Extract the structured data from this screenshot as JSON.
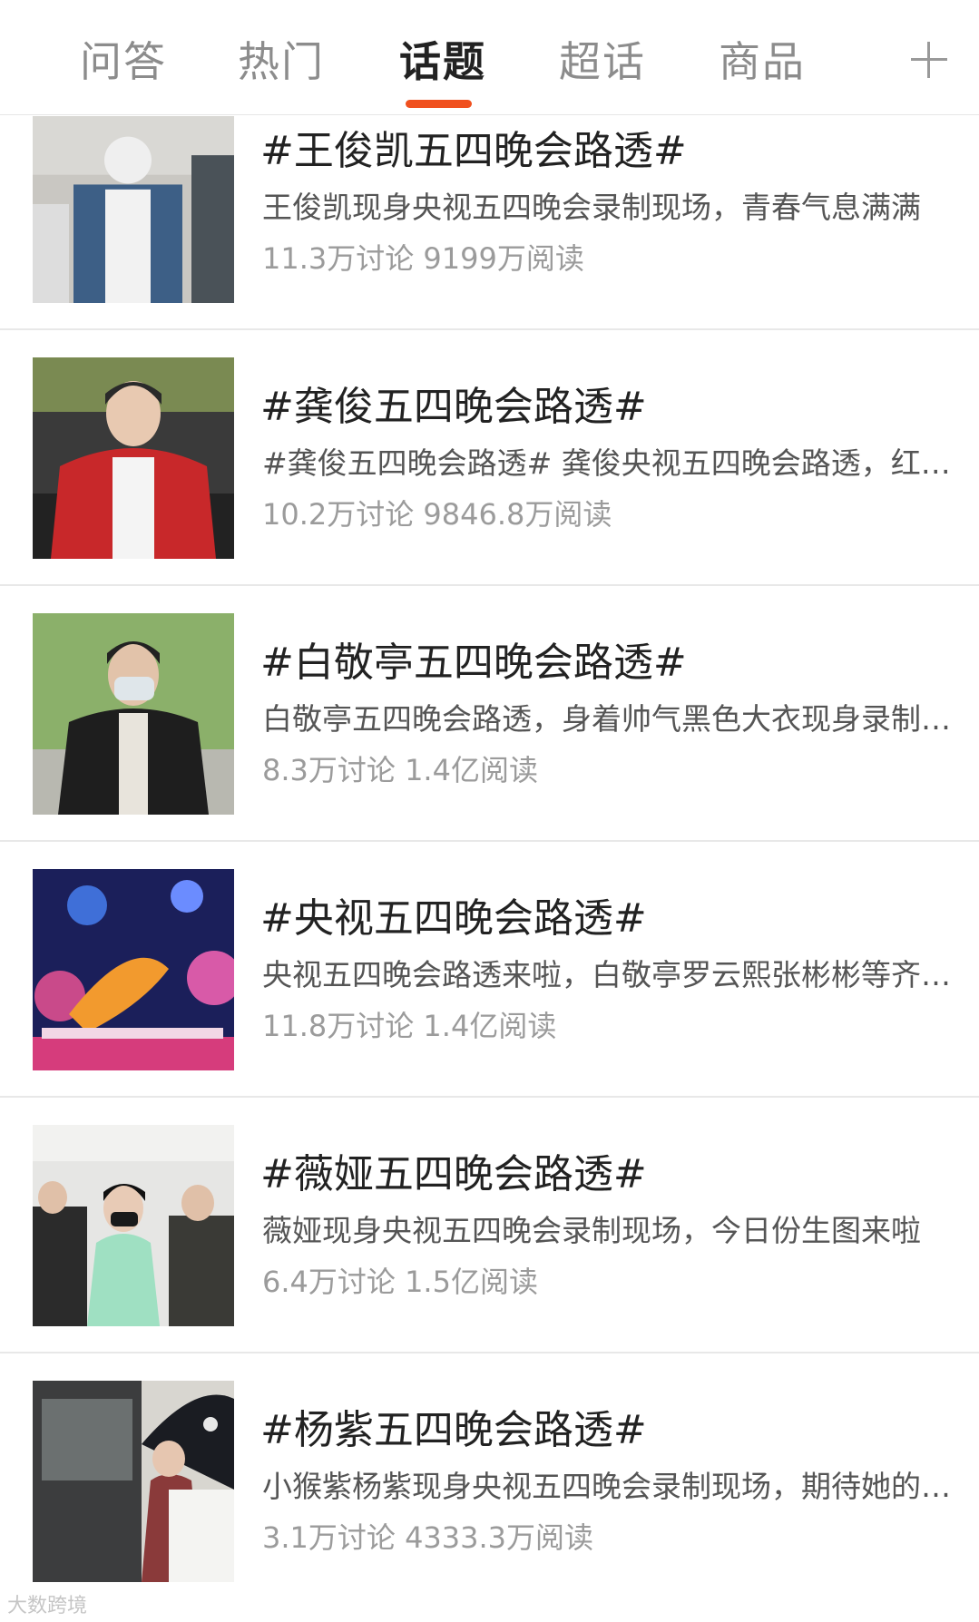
{
  "tabs": [
    {
      "label": "问答"
    },
    {
      "label": "热门"
    },
    {
      "label": "话题",
      "active": true
    },
    {
      "label": "超话"
    },
    {
      "label": "商品"
    }
  ],
  "add_icon": "plus-icon",
  "accent_color": "#f0501e",
  "topics": [
    {
      "title": "#王俊凯五四晚会路透#",
      "desc": "王俊凯现身央视五四晚会录制现场，青春气息满满",
      "stats": "11.3万讨论 9199万阅读"
    },
    {
      "title": "#龚俊五四晚会路透#",
      "desc": "#龚俊五四晚会路透# 龚俊央视五四晚会路透，红色西装帅气亮相",
      "stats": "10.2万讨论 9846.8万阅读"
    },
    {
      "title": "#白敬亭五四晚会路透#",
      "desc": "白敬亭五四晚会路透，身着帅气黑色大衣现身录制现场",
      "stats": "8.3万讨论 1.4亿阅读"
    },
    {
      "title": "#央视五四晚会路透#",
      "desc": "央视五四晚会路透来啦，白敬亭罗云熙张彬彬等齐亮相",
      "stats": "11.8万讨论 1.4亿阅读"
    },
    {
      "title": "#薇娅五四晚会路透#",
      "desc": "薇娅现身央视五四晚会录制现场，今日份生图来啦",
      "stats": "6.4万讨论 1.5亿阅读"
    },
    {
      "title": "#杨紫五四晚会路透#",
      "desc": "小猴紫杨紫现身央视五四晚会录制现场，期待她的表演",
      "stats": "3.1万讨论 4333.3万阅读"
    }
  ],
  "watermark": "大数跨境"
}
